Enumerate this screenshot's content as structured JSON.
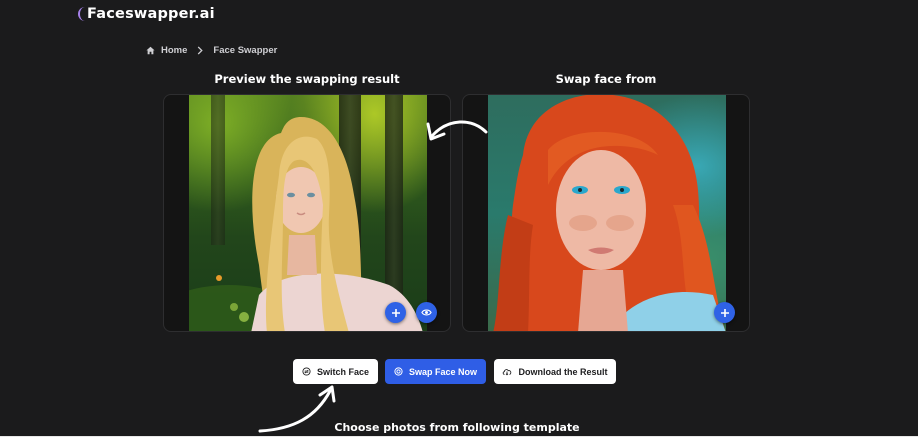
{
  "header": {
    "logo_text": "Faceswapper.ai"
  },
  "breadcrumb": {
    "home_label": "Home",
    "current_label": "Face Swapper"
  },
  "sections": {
    "preview_title": "Preview the swapping result",
    "swap_title": "Swap face from"
  },
  "preview_panel": {
    "image_label": "Preview result photo",
    "add_icon": "plus-icon",
    "view_icon": "eye-icon"
  },
  "swap_panel": {
    "image_label": "Source face photo",
    "add_icon": "plus-icon"
  },
  "actions": {
    "switch_label": "Switch Face",
    "swap_label": "Swap Face Now",
    "download_label": "Download the Result"
  },
  "templates": {
    "title": "Choose photos from following template"
  },
  "colors": {
    "background": "#1b1b1c",
    "accent": "#2f5ee6",
    "panel": "#141414"
  }
}
